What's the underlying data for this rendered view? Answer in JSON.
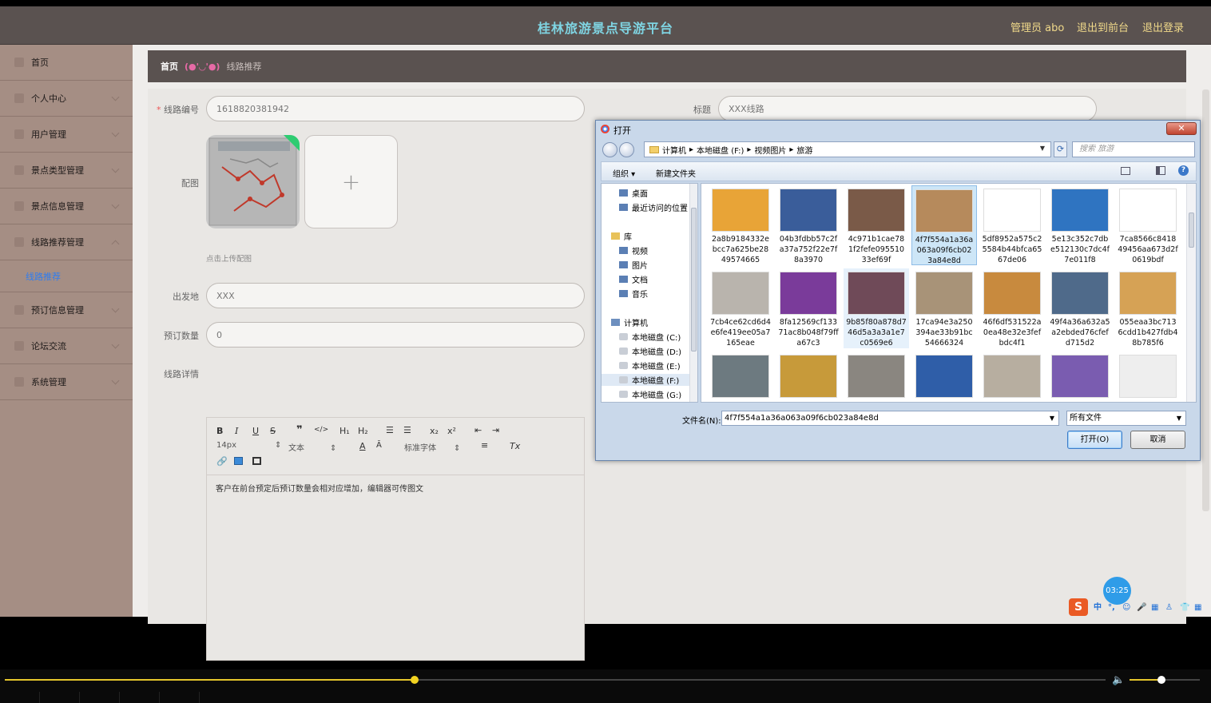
{
  "header": {
    "title": "桂林旅游景点导游平台",
    "admin": "管理员 abo",
    "to_front": "退出到前台",
    "logout": "退出登录"
  },
  "sidebar": {
    "items": [
      {
        "label": "首页"
      },
      {
        "label": "个人中心"
      },
      {
        "label": "用户管理"
      },
      {
        "label": "景点类型管理"
      },
      {
        "label": "景点信息管理"
      },
      {
        "label": "线路推荐管理"
      }
    ],
    "sub_item": "线路推荐",
    "items2": [
      {
        "label": "预订信息管理"
      },
      {
        "label": "论坛交流"
      },
      {
        "label": "系统管理"
      }
    ]
  },
  "breadcrumb": {
    "home": "首页",
    "sep": "(●'◡'●)",
    "current": "线路推荐"
  },
  "form": {
    "route_no_label": "线路编号",
    "route_no_value": "1618820381942",
    "title_label": "标题",
    "title_value": "XXX线路",
    "image_label": "配图",
    "upload_hint": "点击上传配图",
    "departure_label": "出发地",
    "departure_value": "XXX",
    "booking_label": "预订数量",
    "booking_value": "0",
    "detail_label": "线路详情"
  },
  "editor": {
    "font_size": "14px",
    "block": "文本",
    "font": "标准字体",
    "content": "客户在前台预定后预订数量会相对应增加，编辑器可传图文"
  },
  "dialog": {
    "title": "打开",
    "close": "✕",
    "path": [
      "计算机",
      "本地磁盘 (F:)",
      "视频图片",
      "旅游"
    ],
    "search_placeholder": "搜索 旅游",
    "organize": "组织 ▾",
    "new_folder": "新建文件夹",
    "nav": [
      {
        "label": "桌面",
        "type": "fold"
      },
      {
        "label": "最近访问的位置",
        "type": "fold"
      },
      {
        "label": "库",
        "type": "lib"
      },
      {
        "label": "视频",
        "type": "fold"
      },
      {
        "label": "图片",
        "type": "fold"
      },
      {
        "label": "文档",
        "type": "fold"
      },
      {
        "label": "音乐",
        "type": "fold"
      },
      {
        "label": "计算机",
        "type": "pc"
      },
      {
        "label": "本地磁盘 (C:)",
        "type": "disk"
      },
      {
        "label": "本地磁盘 (D:)",
        "type": "disk"
      },
      {
        "label": "本地磁盘 (E:)",
        "type": "disk"
      },
      {
        "label": "本地磁盘 (F:)",
        "type": "disk"
      },
      {
        "label": "本地磁盘 (G:)",
        "type": "disk"
      }
    ],
    "files": [
      {
        "name": "2a8b9184332ebcc7a625be2849574665",
        "color": "#e8a437"
      },
      {
        "name": "04b3fdbb57c2fa37a752f22e7f8a3970",
        "color": "#3a5d9a"
      },
      {
        "name": "4c971b1cae781f2fefe09551033ef69f",
        "color": "#7a5a48"
      },
      {
        "name": "4f7f554a1a36a063a09f6cb023a84e8d",
        "color": "#b68a5c"
      },
      {
        "name": "5df8952a575c25584b44bfca6567de06",
        "color": "#ffffff"
      },
      {
        "name": "5e13c352c7dbe512130c7dc4f7e011f8",
        "color": "#2f74c1"
      },
      {
        "name": "7ca8566c841849456aa673d2f0619bdf",
        "color": "#ffffff"
      },
      {
        "name": "7cb4ce62cd6d4e6fe419ee05a7165eae",
        "color": "#b9b4ad"
      },
      {
        "name": "8fa12569cf13371ac8b048f79ffa67c3",
        "color": "#7a3b9a"
      },
      {
        "name": "9b85f80a878d746d5a3a3a1e7c0569e6",
        "color": "#6f4a58"
      },
      {
        "name": "17ca94e3a250394ae33b91bc54666324",
        "color": "#a89378"
      },
      {
        "name": "46f6df531522a0ea48e32e3fefbdc4f1",
        "color": "#c88a3e"
      },
      {
        "name": "49f4a36a632a5a2ebded76cfefd715d2",
        "color": "#4f6a8a"
      },
      {
        "name": "055eaa3bc7136cdd1b427fdb48b785f6",
        "color": "#d6a255"
      },
      {
        "name": "",
        "color": "#6d7a80"
      },
      {
        "name": "",
        "color": "#c79a3a"
      },
      {
        "name": "",
        "color": "#8a8680"
      },
      {
        "name": "",
        "color": "#2f5ea8"
      },
      {
        "name": "",
        "color": "#b7aea0"
      },
      {
        "name": "",
        "color": "#7a5cb0"
      },
      {
        "name": "",
        "color": "#eeeeee"
      }
    ],
    "filename_label": "文件名(N):",
    "filename_value": "4f7f554a1a36a063a09f6cb023a84e8d",
    "filetype": "所有文件",
    "open_btn": "打开(O)",
    "cancel_btn": "取消"
  },
  "timer": "03:25",
  "ime": {
    "logo": "S",
    "icons": [
      "中",
      "°,",
      "☺",
      "🎤",
      "▦",
      "♙",
      "👕",
      "▦"
    ]
  },
  "player": {
    "progress": 0.372,
    "volume": 0.45
  }
}
